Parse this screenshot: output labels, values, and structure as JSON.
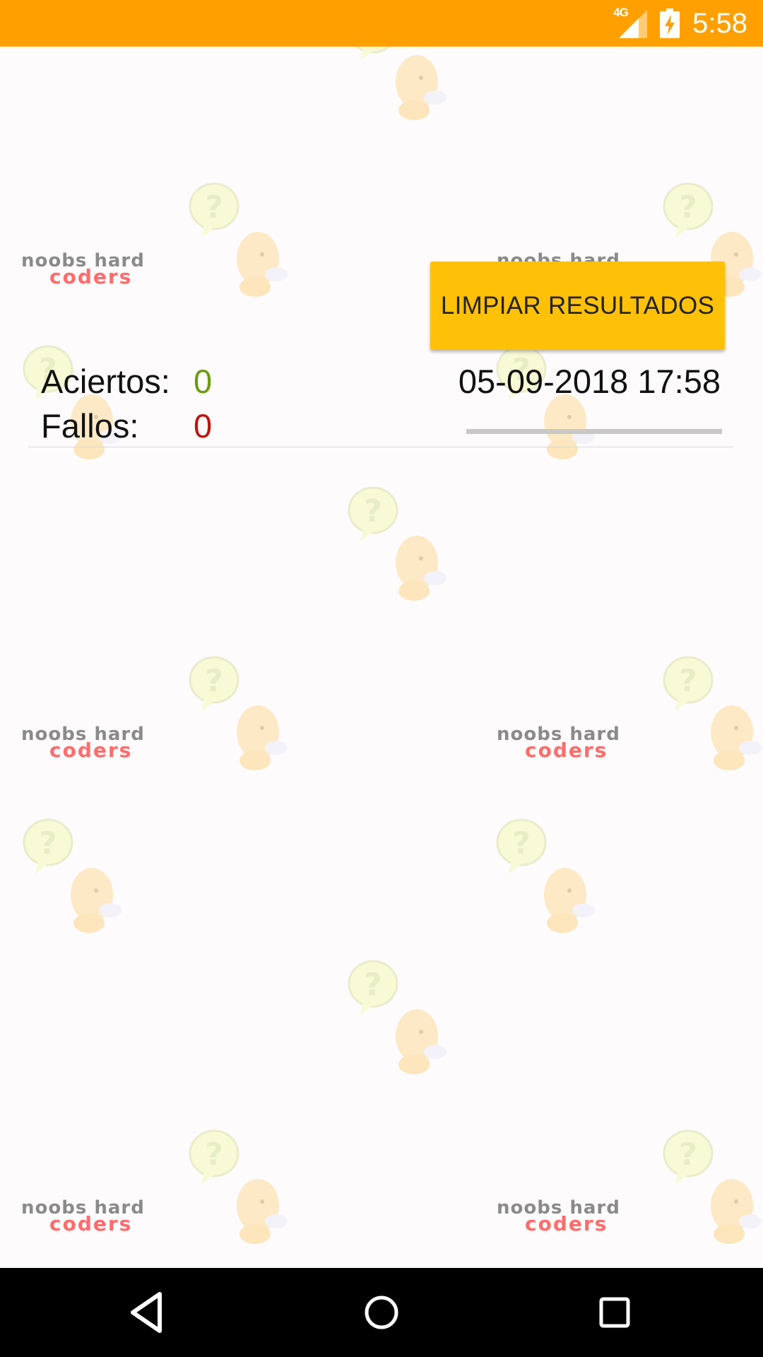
{
  "status_bar": {
    "background": "#ffa000",
    "network_type": "4G",
    "signal_icon": "cell-signal-icon",
    "battery_icon": "battery-charging-icon",
    "time": "5:58"
  },
  "watermark": {
    "line1": "noobs hard",
    "line2": "coders",
    "icon": "question-bubble-chick-icon"
  },
  "actions": {
    "clear_label": "LIMPIAR RESULTADOS",
    "clear_color": "#ffc107"
  },
  "stats": {
    "hits_label": "Aciertos:",
    "hits_value": "0",
    "hits_color": "#6b9b0e",
    "fails_label": "Fallos:",
    "fails_value": "0",
    "fails_color": "#c0140c"
  },
  "session": {
    "datetime": "05-09-2018 17:58",
    "progress_percent": 0
  },
  "nav_bar": {
    "back_icon": "back-triangle-icon",
    "home_icon": "home-circle-icon",
    "recents_icon": "recents-square-icon"
  }
}
